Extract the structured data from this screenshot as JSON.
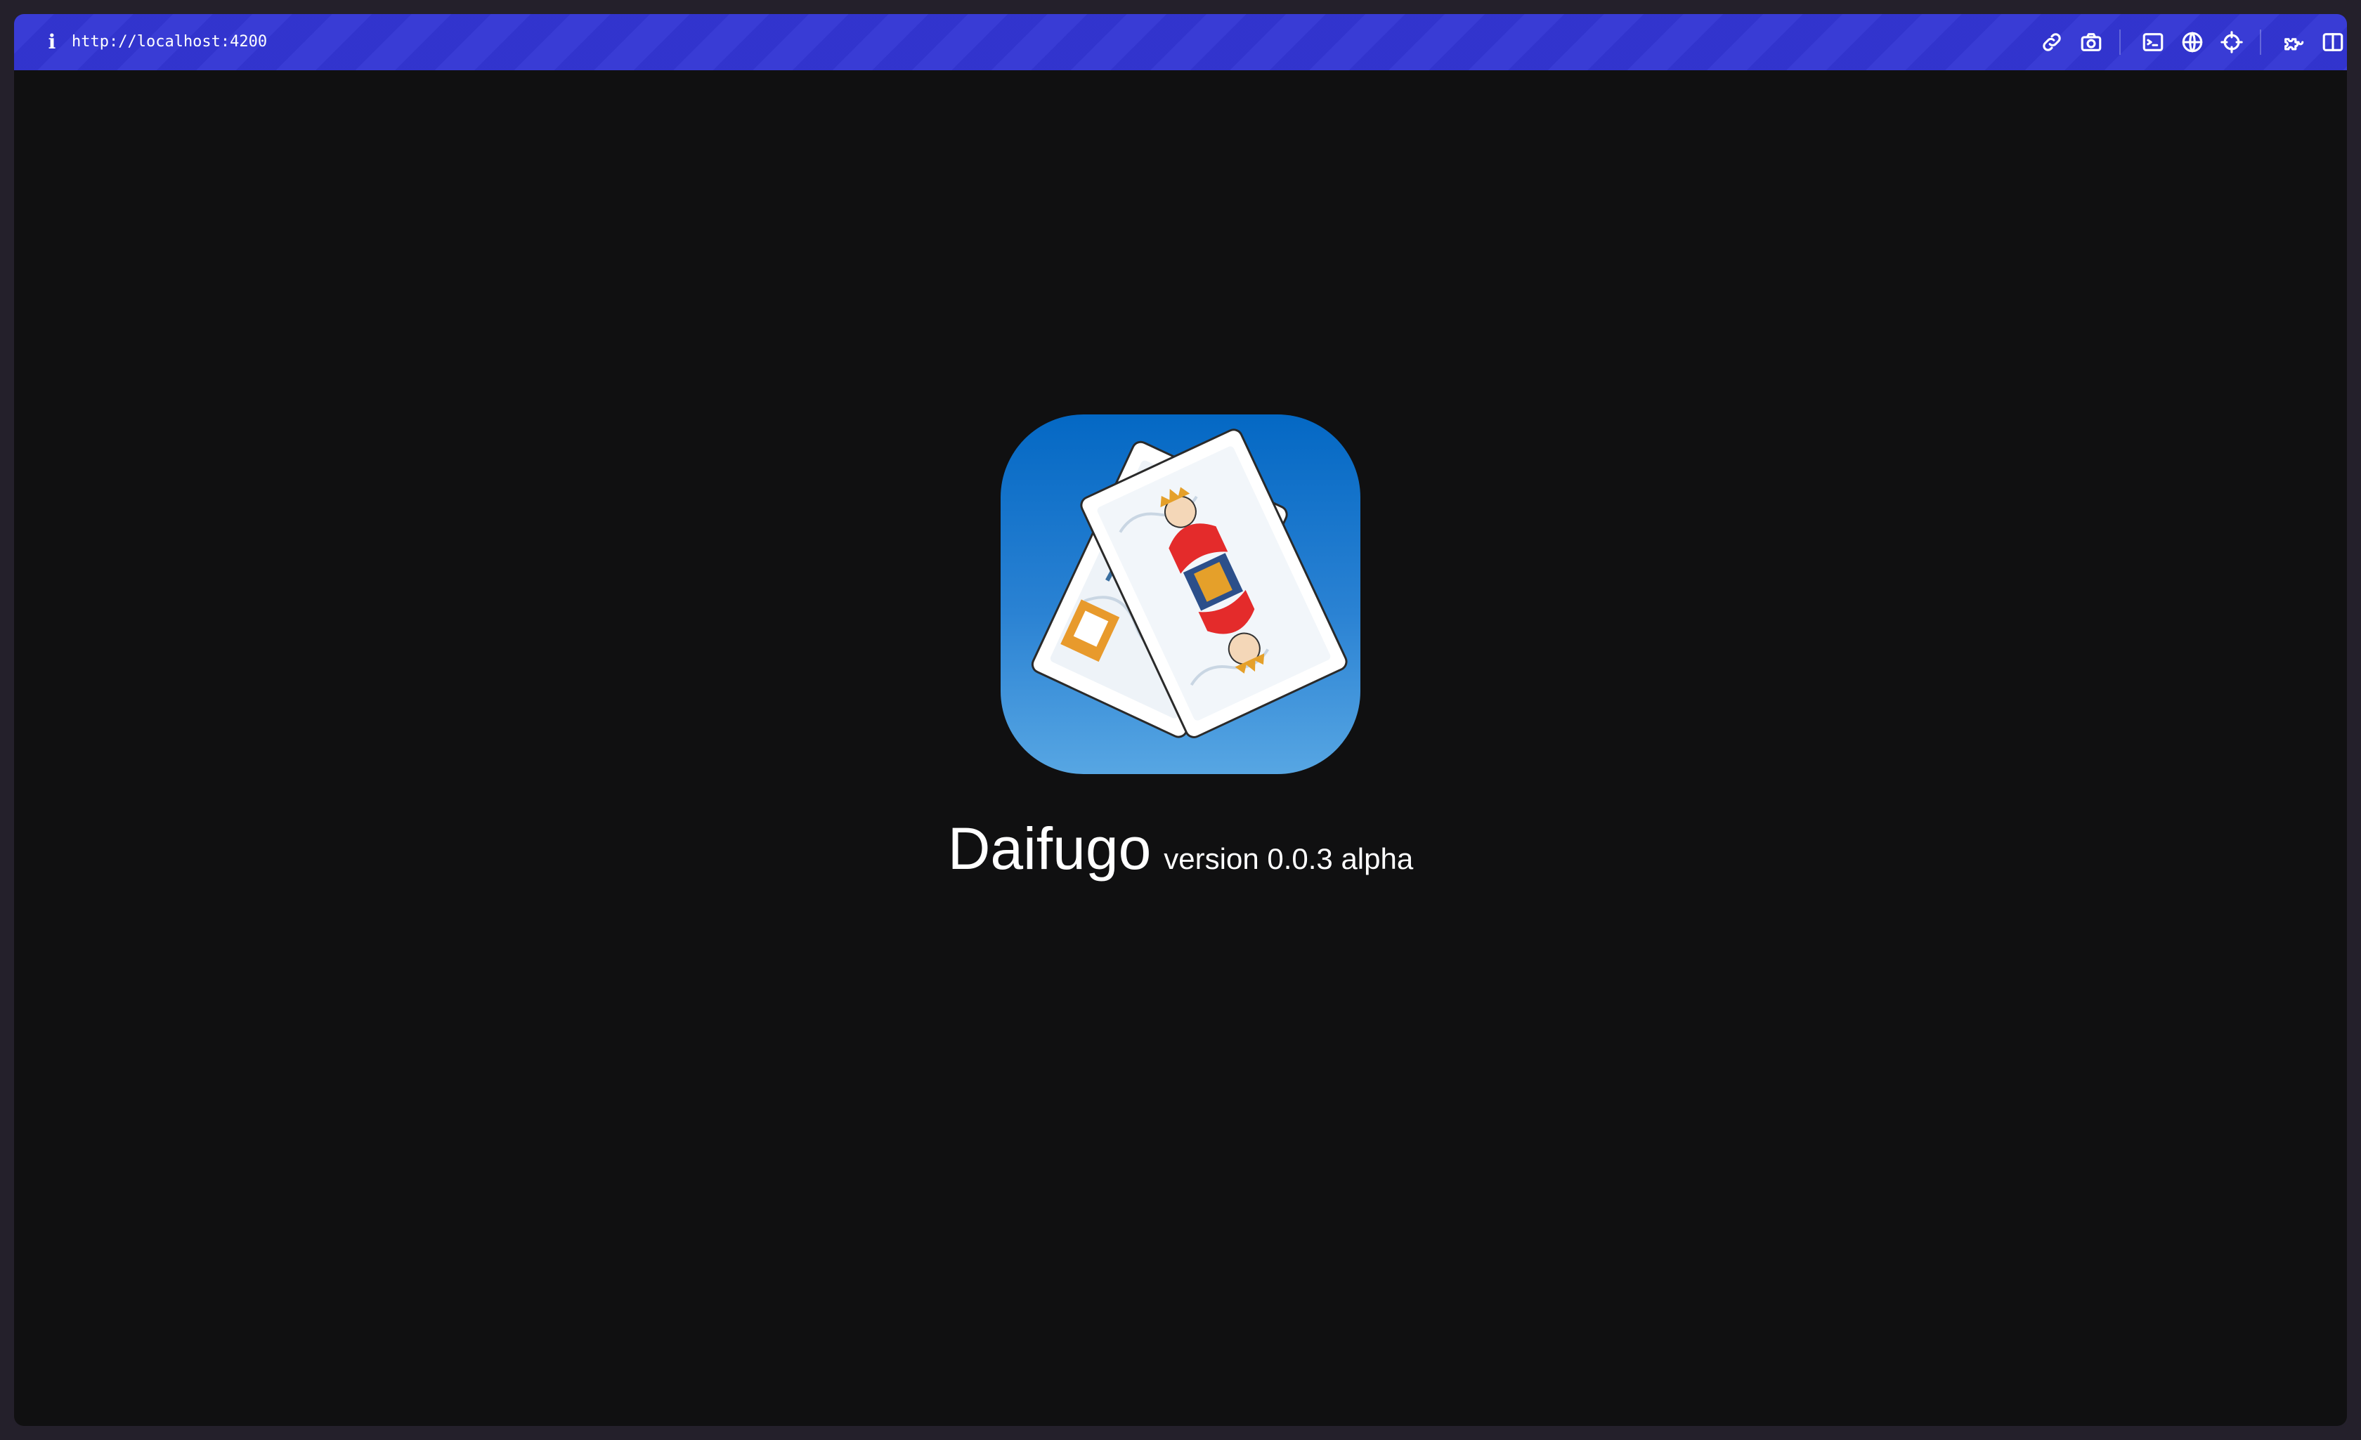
{
  "browser": {
    "url": "http://localhost:4200",
    "toolbar_icons": [
      "link-icon",
      "camera-icon",
      "terminal-icon",
      "globe-icon",
      "crosshair-icon",
      "extension-icon",
      "split-panel-icon"
    ],
    "accent_color": "#3336d4"
  },
  "app": {
    "name": "Daifugo",
    "version": "version 0.0.3 alpha",
    "icon_background": "#0468c4"
  }
}
